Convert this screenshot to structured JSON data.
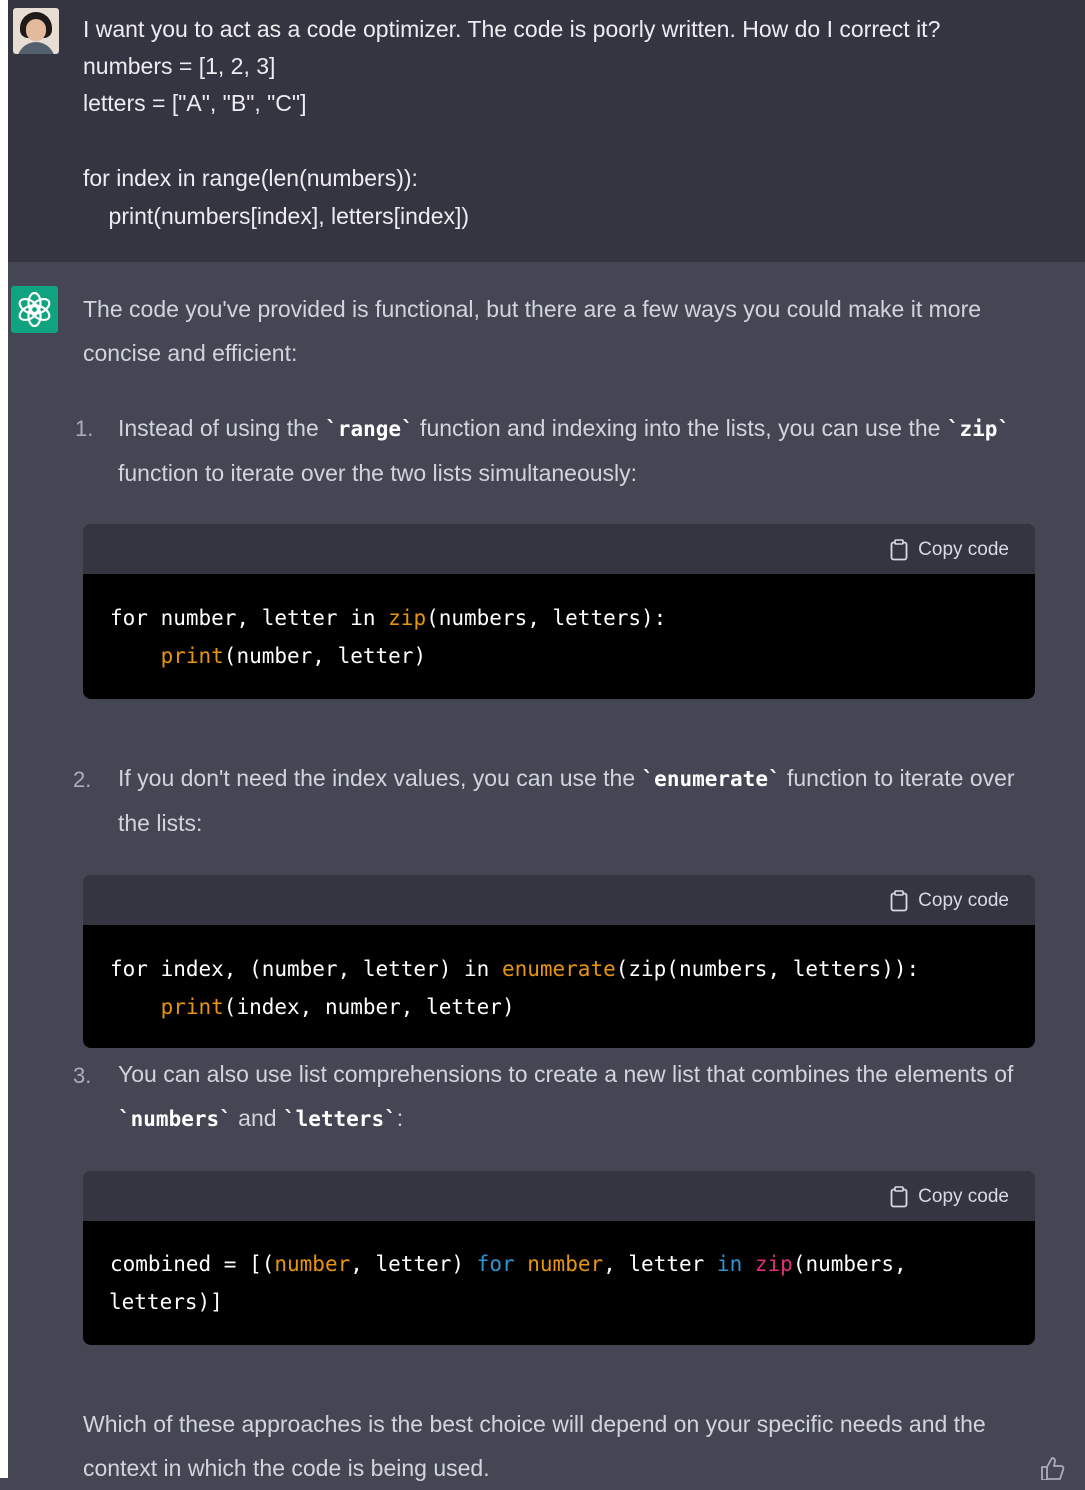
{
  "user_message": {
    "lines": [
      "I want you to act as a code optimizer. The code is poorly written. How do I correct it?",
      "numbers = [1, 2, 3]",
      "letters = [\"A\", \"B\", \"C\"]",
      "",
      "for index in range(len(numbers)):",
      "    print(numbers[index], letters[index])"
    ]
  },
  "assistant": {
    "intro": "The code you've provided is functional, but there are a few ways you could make it more concise and efficient:",
    "items": [
      {
        "num": "1.",
        "t1": "Instead of using the ",
        "c1": "`range`",
        "t2": " function and indexing into the lists, you can use the ",
        "c2": "`zip`",
        "t3": " function to iterate over the two lists simultaneously:",
        "copy_label": "Copy code",
        "code": {
          "l1_a": "for number, letter in ",
          "l1_b": "zip",
          "l1_c": "(numbers, letters):",
          "l2_a": "    ",
          "l2_b": "print",
          "l2_c": "(number, letter)"
        }
      },
      {
        "num": "2.",
        "t1": "If you don't need the index values, you can use the ",
        "c1": "`enumerate`",
        "t2": " function to iterate over the lists:",
        "copy_label": "Copy code",
        "code": {
          "l1_a": "for index, (number, letter) in ",
          "l1_b": "enumerate",
          "l1_c": "(zip(numbers, letters)):",
          "l2_a": "    ",
          "l2_b": "print",
          "l2_c": "(index, number, letter)"
        }
      },
      {
        "num": "3.",
        "t1": "You can also use list comprehensions to create a new list that combines the elements of ",
        "c1": "`numbers`",
        "t2": " and ",
        "c2": "`letters`",
        "t3": ":",
        "copy_label": "Copy code",
        "code": {
          "l1_a": "combined = [(",
          "l1_b": "number",
          "l1_c": ", letter) ",
          "l1_d": "for",
          "l1_e": " ",
          "l1_f": "number",
          "l1_g": ", letter ",
          "l1_h": "in",
          "l1_i": " ",
          "l1_j": "zip",
          "l1_k": "(numbers,",
          "l2": "letters)]"
        }
      }
    ],
    "conclusion": "Which of these approaches is the best choice will depend on your specific needs and the context in which the code is being used."
  },
  "colors": {
    "user_bg": "#343541",
    "assistant_bg": "#444654",
    "code_bg": "#000000",
    "accent": "#10a37f",
    "token_orange": "#e9950c",
    "token_blue": "#2e95d3",
    "token_red": "#df3079"
  }
}
